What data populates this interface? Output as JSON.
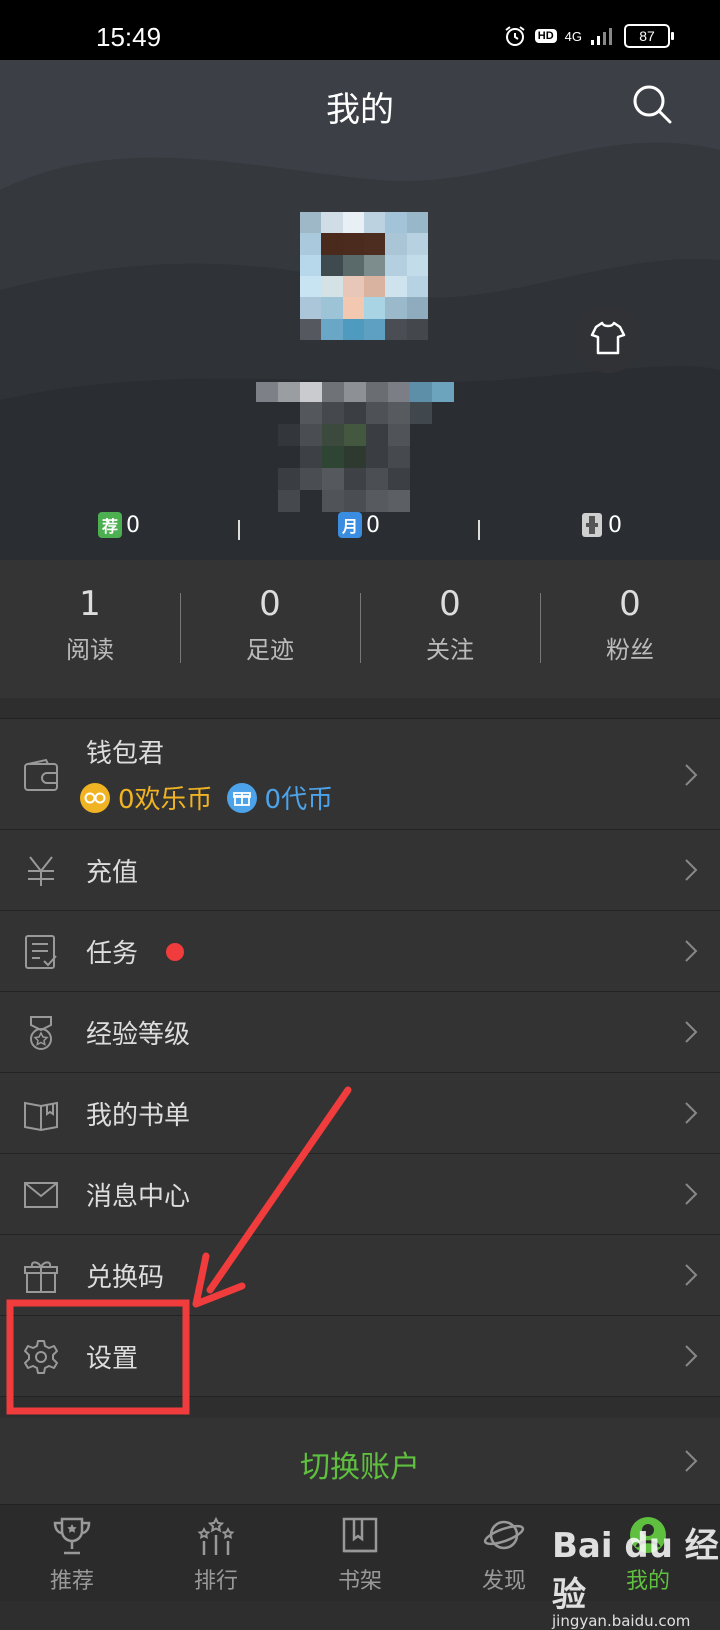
{
  "status_bar": {
    "time": "15:49",
    "hd": "HD",
    "network": "4G",
    "battery": "87"
  },
  "header": {
    "title": "我的",
    "tickets": [
      {
        "badge": "荐",
        "color": "#4caf50",
        "count": "0"
      },
      {
        "badge": "月",
        "color": "#3a8de0",
        "count": "0"
      },
      {
        "badge": "",
        "color": "#bbbbbb",
        "count": "0"
      }
    ]
  },
  "stats": [
    {
      "value": "1",
      "label": "阅读"
    },
    {
      "value": "0",
      "label": "足迹"
    },
    {
      "value": "0",
      "label": "关注"
    },
    {
      "value": "0",
      "label": "粉丝"
    }
  ],
  "wallet": {
    "label": "钱包君",
    "happy_coins": "0欢乐币",
    "vouchers": "0代币"
  },
  "menu": [
    {
      "label": "充值",
      "icon": "yen-icon"
    },
    {
      "label": "任务",
      "icon": "task-icon"
    },
    {
      "label": "经验等级",
      "icon": "medal-icon"
    },
    {
      "label": "我的书单",
      "icon": "book-list-icon"
    },
    {
      "label": "消息中心",
      "icon": "mail-icon"
    },
    {
      "label": "兑换码",
      "icon": "gift-icon"
    },
    {
      "label": "设置",
      "icon": "gear-icon"
    }
  ],
  "switch_account": "切换账户",
  "tabs": [
    {
      "label": "推荐",
      "icon": "trophy-icon"
    },
    {
      "label": "排行",
      "icon": "rank-icon"
    },
    {
      "label": "书架",
      "icon": "bookshelf-icon"
    },
    {
      "label": "发现",
      "icon": "planet-icon"
    },
    {
      "label": "我的",
      "icon": "user-icon",
      "active": true
    }
  ],
  "watermark": {
    "brand": "Bai du 经验",
    "site": "jingyan.baidu.com"
  },
  "colors": {
    "accent_green": "#5fbf3e",
    "happy_coin": "#f0b323",
    "voucher": "#4da3ea",
    "annotation_red": "#f03c3c"
  }
}
